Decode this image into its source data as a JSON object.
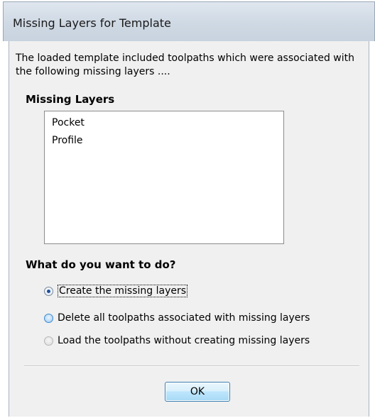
{
  "dialog": {
    "title": "Missing Layers for Template",
    "description": "The loaded template included toolpaths which were associated with the following missing layers ...."
  },
  "missing_layers": {
    "heading": "Missing Layers",
    "items": [
      "Pocket",
      "Profile"
    ]
  },
  "action": {
    "heading": "What do you want to do?",
    "options": [
      {
        "label": "Create the missing layers",
        "selected": true
      },
      {
        "label": "Delete all toolpaths associated with missing layers",
        "selected": false
      },
      {
        "label": "Load the toolpaths without creating missing layers",
        "selected": false
      }
    ]
  },
  "buttons": {
    "ok_label": "OK"
  }
}
